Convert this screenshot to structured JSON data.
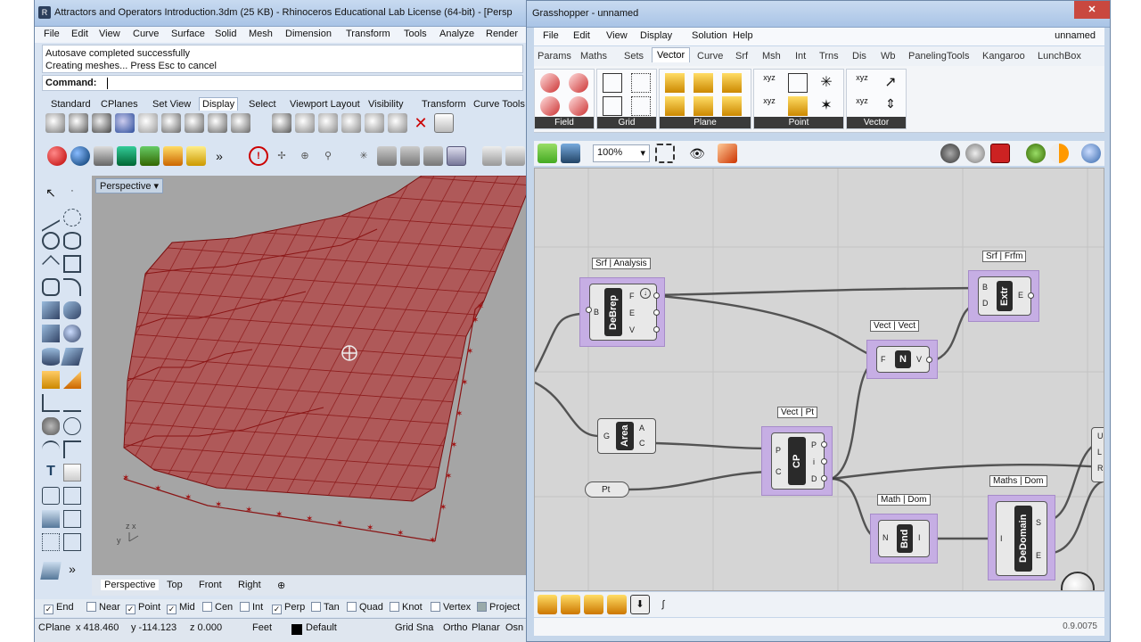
{
  "rhino": {
    "title": "Attractors and Operators Introduction.3dm (25 KB) - Rhinoceros Educational Lab License (64-bit) - [Persp",
    "menu": [
      "File",
      "Edit",
      "View",
      "Curve",
      "Surface",
      "Solid",
      "Mesh",
      "Dimension",
      "Transform",
      "Tools",
      "Analyze",
      "Render"
    ],
    "history": [
      "Autosave completed successfully",
      "Creating meshes... Press Esc to cancel"
    ],
    "command_label": "Command:",
    "tabs": [
      "Standard",
      "CPlanes",
      "Set View",
      "Display",
      "Select",
      "Viewport Layout",
      "Visibility",
      "Transform",
      "Curve Tools"
    ],
    "active_tab": "Display",
    "viewport_label": "Perspective",
    "viewport_tabs": [
      "Perspective",
      "Top",
      "Front",
      "Right"
    ],
    "axis_labels": {
      "y": "y",
      "z": "z",
      "x": "x"
    },
    "osnaps": [
      {
        "label": "End",
        "checked": true
      },
      {
        "label": "Near",
        "checked": false
      },
      {
        "label": "Point",
        "checked": true
      },
      {
        "label": "Mid",
        "checked": true
      },
      {
        "label": "Cen",
        "checked": false
      },
      {
        "label": "Int",
        "checked": false
      },
      {
        "label": "Perp",
        "checked": true
      },
      {
        "label": "Tan",
        "checked": false
      },
      {
        "label": "Quad",
        "checked": false
      },
      {
        "label": "Knot",
        "checked": false
      },
      {
        "label": "Vertex",
        "checked": false
      },
      {
        "label": "Project",
        "checked": false
      }
    ],
    "status": {
      "cplane": "CPlane",
      "x": "x 418.460",
      "y": "y -114.123",
      "z": "z 0.000",
      "units": "Feet",
      "layer": "Default",
      "grid_snap": "Grid Sna",
      "ortho": "Ortho",
      "planar": "Planar",
      "osnap": "Osn"
    },
    "accent_red": "#b71c1c"
  },
  "gh": {
    "title": "Grasshopper - unnamed",
    "doc_name": "unnamed",
    "menu": [
      "File",
      "Edit",
      "View",
      "Display",
      "Solution",
      "Help"
    ],
    "tabs": [
      "Params",
      "Maths",
      "Sets",
      "Vector",
      "Curve",
      "Srf",
      "Msh",
      "Int",
      "Trns",
      "Dis",
      "Wb",
      "PanelingTools",
      "Kangaroo",
      "LunchBox"
    ],
    "active_tab": "Vector",
    "groups": [
      "Field",
      "Grid",
      "Plane",
      "Point",
      "Vector"
    ],
    "zoom": "100%",
    "version": "0.9.0075",
    "components": {
      "debrep": {
        "tag": "Srf | Analysis",
        "nick": "DeBrep",
        "in": [
          "B"
        ],
        "out": [
          "F",
          "E",
          "V"
        ]
      },
      "extr": {
        "tag": "Srf | Frfm",
        "nick": "Extr",
        "in": [
          "B",
          "D"
        ],
        "out": [
          "E"
        ]
      },
      "unit": {
        "tag": "Vect | Vect",
        "nick": "N",
        "in": [
          "F"
        ],
        "out": [
          "V"
        ]
      },
      "area": {
        "nick": "Area",
        "in": [
          "G"
        ],
        "out": [
          "A",
          "C"
        ]
      },
      "cp": {
        "tag": "Vect | Pt",
        "nick": "CP",
        "in": [
          "P",
          "C"
        ],
        "out": [
          "P",
          "i",
          "D"
        ]
      },
      "pt": {
        "nick": "Pt"
      },
      "bnd": {
        "tag": "Math | Dom",
        "nick": "Bnd",
        "in": [
          "N"
        ],
        "out": [
          "I"
        ]
      },
      "dedomain": {
        "tag": "Maths | Dom",
        "nick": "DeDomain",
        "in": [
          "I"
        ],
        "out": [
          "S",
          "E"
        ]
      },
      "edge_ports": [
        "U",
        "L",
        "R"
      ]
    },
    "group_color": "#c6aee4"
  }
}
